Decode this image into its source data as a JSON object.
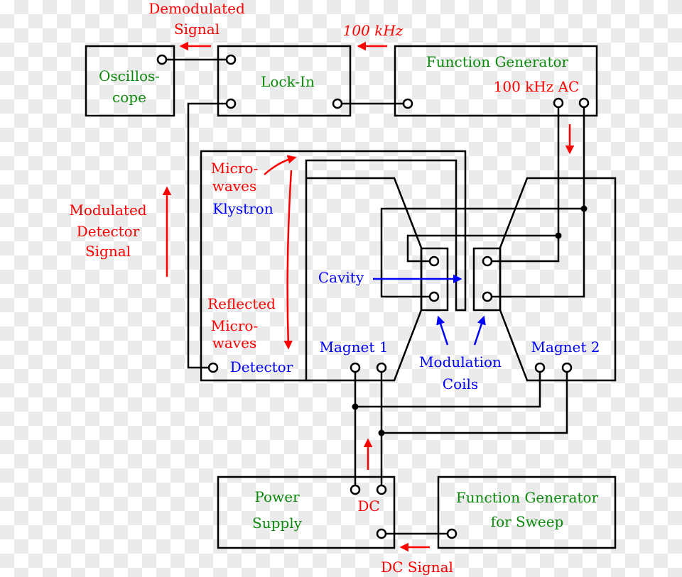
{
  "labels": {
    "demodulated": [
      "Demodulated",
      "Signal"
    ],
    "freq_top": "100 kHz",
    "function_generator": "Function Generator",
    "fg_output": "100 kHz AC",
    "oscilloscope": [
      "Oscillos-",
      "cope"
    ],
    "lock_in": "Lock-In",
    "microwaves": [
      "Micro-",
      "waves"
    ],
    "klystron": "Klystron",
    "modulated": [
      "Modulated",
      "Detector",
      "Signal"
    ],
    "reflected": [
      "Reflected",
      "Micro-",
      "waves"
    ],
    "detector": "Detector",
    "cavity": "Cavity",
    "magnet1": "Magnet 1",
    "magnet2": "Magnet 2",
    "modulation_coils": [
      "Modulation",
      "Coils"
    ],
    "power_supply": [
      "Power",
      "Supply"
    ],
    "dc": "DC",
    "sweep_generator": [
      "Function Generator",
      "for Sweep"
    ],
    "dc_signal": "DC Signal"
  },
  "colors": {
    "equipment": "#0a8a0a",
    "signals": "#ff0000",
    "components": "#0000ff",
    "wires": "#000000"
  }
}
